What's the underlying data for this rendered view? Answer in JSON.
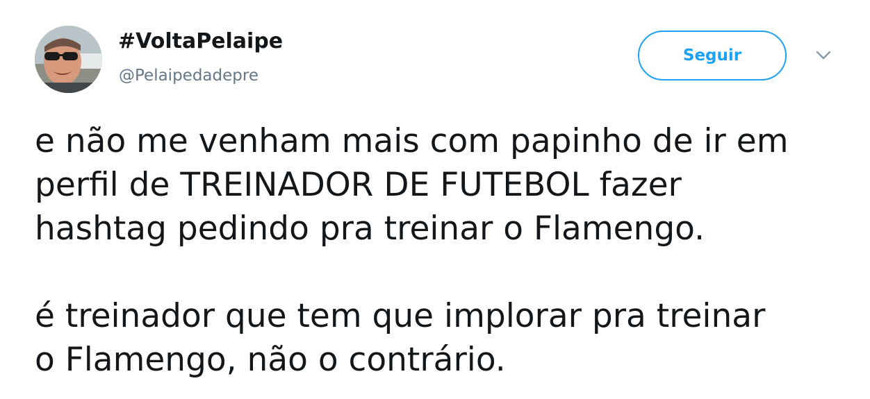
{
  "tweet": {
    "author": {
      "display_name": "#VoltaPelaipe",
      "handle": "@Pelaipedadepre",
      "avatar_icon": "user-avatar"
    },
    "follow_button_label": "Seguir",
    "menu_icon": "chevron-down-icon",
    "text_lines": [
      "e não me venham mais com papinho de ir em",
      "perfil de TREINADOR DE FUTEBOL fazer",
      "hashtag pedindo pra treinar o Flamengo.",
      "é treinador que tem que implorar pra treinar",
      "o Flamengo, não o contrário."
    ]
  },
  "colors": {
    "accent": "#1da1f2",
    "text": "#14171a",
    "secondary_text": "#657786"
  }
}
